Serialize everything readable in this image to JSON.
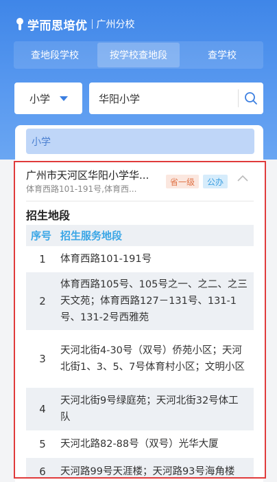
{
  "brand": {
    "name": "学而思培优",
    "branch": "广州分校"
  },
  "tabs": [
    {
      "label": "查地段学校",
      "active": false
    },
    {
      "label": "按学校查地段",
      "active": true
    },
    {
      "label": "查学校",
      "active": false
    }
  ],
  "search": {
    "level_value": "小学",
    "query_value": "华阳小学"
  },
  "level_bar": "小学",
  "school": {
    "name": "广州市天河区华阳小学华...",
    "address": "体育西路101-191号,体育西...",
    "badge_level": "省一级",
    "badge_type": "公办"
  },
  "section_title": "招生地段",
  "table": {
    "headers": {
      "index": "序号",
      "zone": "招生服务地段"
    },
    "rows": [
      {
        "index": "1",
        "zone": "体育西路101-191号"
      },
      {
        "index": "2",
        "zone": "体育西路105号、105号之一、之二、之三天文苑；体育西路127－131号、131-1号、131-2号西雅苑"
      },
      {
        "index": "3",
        "zone": "天河北街4-30号（双号）侨苑小区；天河北街1、3、5、7号体育村小区；文明小区"
      },
      {
        "index": "4",
        "zone": "天河北街9号绿庭苑；天河北街32号体工队"
      },
      {
        "index": "5",
        "zone": "天河北路82-88号（双号）光华大厦"
      },
      {
        "index": "6",
        "zone": "天河路99号天涯楼；天河路93号海角楼"
      }
    ]
  },
  "colors": {
    "primary": "#3f86e8",
    "highlight_border": "#e03a3a",
    "header_text": "#3aa6e6"
  }
}
